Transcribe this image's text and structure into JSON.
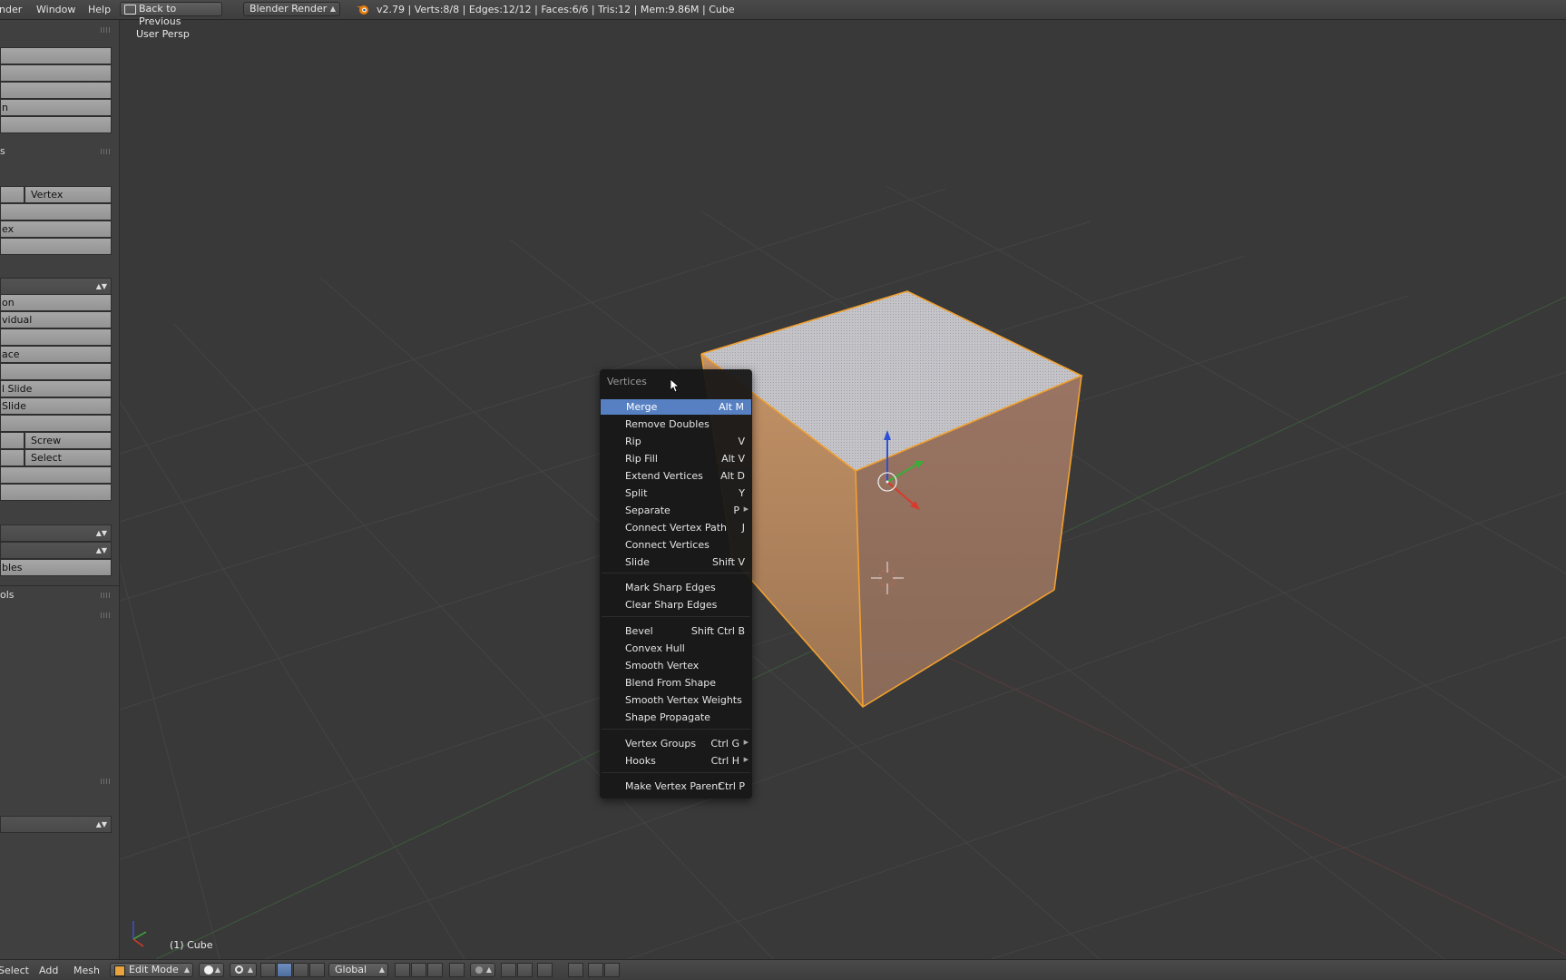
{
  "top_bar": {
    "menus": [
      "nder",
      "Window",
      "Help"
    ],
    "back_button": "Back to Previous",
    "render_engine": "Blender Render",
    "stats": "v2.79 | Verts:8/8 | Edges:12/12 | Faces:6/6 | Tris:12 | Mem:9.86M | Cube"
  },
  "tool_shelf": {
    "section_headers": [
      "s",
      "ols"
    ],
    "buttons": [
      "Vertex",
      "ex",
      "on",
      "vidual",
      "ace",
      "l Slide",
      "Slide",
      "Screw",
      "Select",
      "bles"
    ]
  },
  "viewport": {
    "view_label": "User Persp",
    "object_label": "(1) Cube"
  },
  "context_menu": {
    "title": "Vertices",
    "items": [
      {
        "label": "Merge",
        "shortcut": "Alt M"
      },
      {
        "label": "Remove Doubles",
        "shortcut": ""
      },
      {
        "label": "Rip",
        "shortcut": "V"
      },
      {
        "label": "Rip Fill",
        "shortcut": "Alt V"
      },
      {
        "label": "Extend Vertices",
        "shortcut": "Alt D"
      },
      {
        "label": "Split",
        "shortcut": "Y"
      },
      {
        "label": "Separate",
        "shortcut": "P"
      },
      {
        "label": "Connect Vertex Path",
        "shortcut": "J"
      },
      {
        "label": "Connect Vertices",
        "shortcut": ""
      },
      {
        "label": "Slide",
        "shortcut": "Shift V"
      },
      {
        "label": "Mark Sharp Edges",
        "shortcut": ""
      },
      {
        "label": "Clear Sharp Edges",
        "shortcut": ""
      },
      {
        "label": "Bevel",
        "shortcut": "Shift Ctrl B"
      },
      {
        "label": "Convex Hull",
        "shortcut": ""
      },
      {
        "label": "Smooth Vertex",
        "shortcut": ""
      },
      {
        "label": "Blend From Shape",
        "shortcut": ""
      },
      {
        "label": "Smooth Vertex Weights",
        "shortcut": ""
      },
      {
        "label": "Shape Propagate",
        "shortcut": ""
      },
      {
        "label": "Vertex Groups",
        "shortcut": "Ctrl G"
      },
      {
        "label": "Hooks",
        "shortcut": "Ctrl H"
      },
      {
        "label": "Make Vertex Parent",
        "shortcut": "Ctrl P"
      }
    ]
  },
  "bottom_bar": {
    "menus": [
      "Select",
      "Add",
      "Mesh"
    ],
    "mode": "Edit Mode",
    "orientation": "Global"
  },
  "colors": {
    "viewport_bg": "#393939",
    "menu_highlight": "#5680c2",
    "selection_orange": "#f0a030"
  }
}
